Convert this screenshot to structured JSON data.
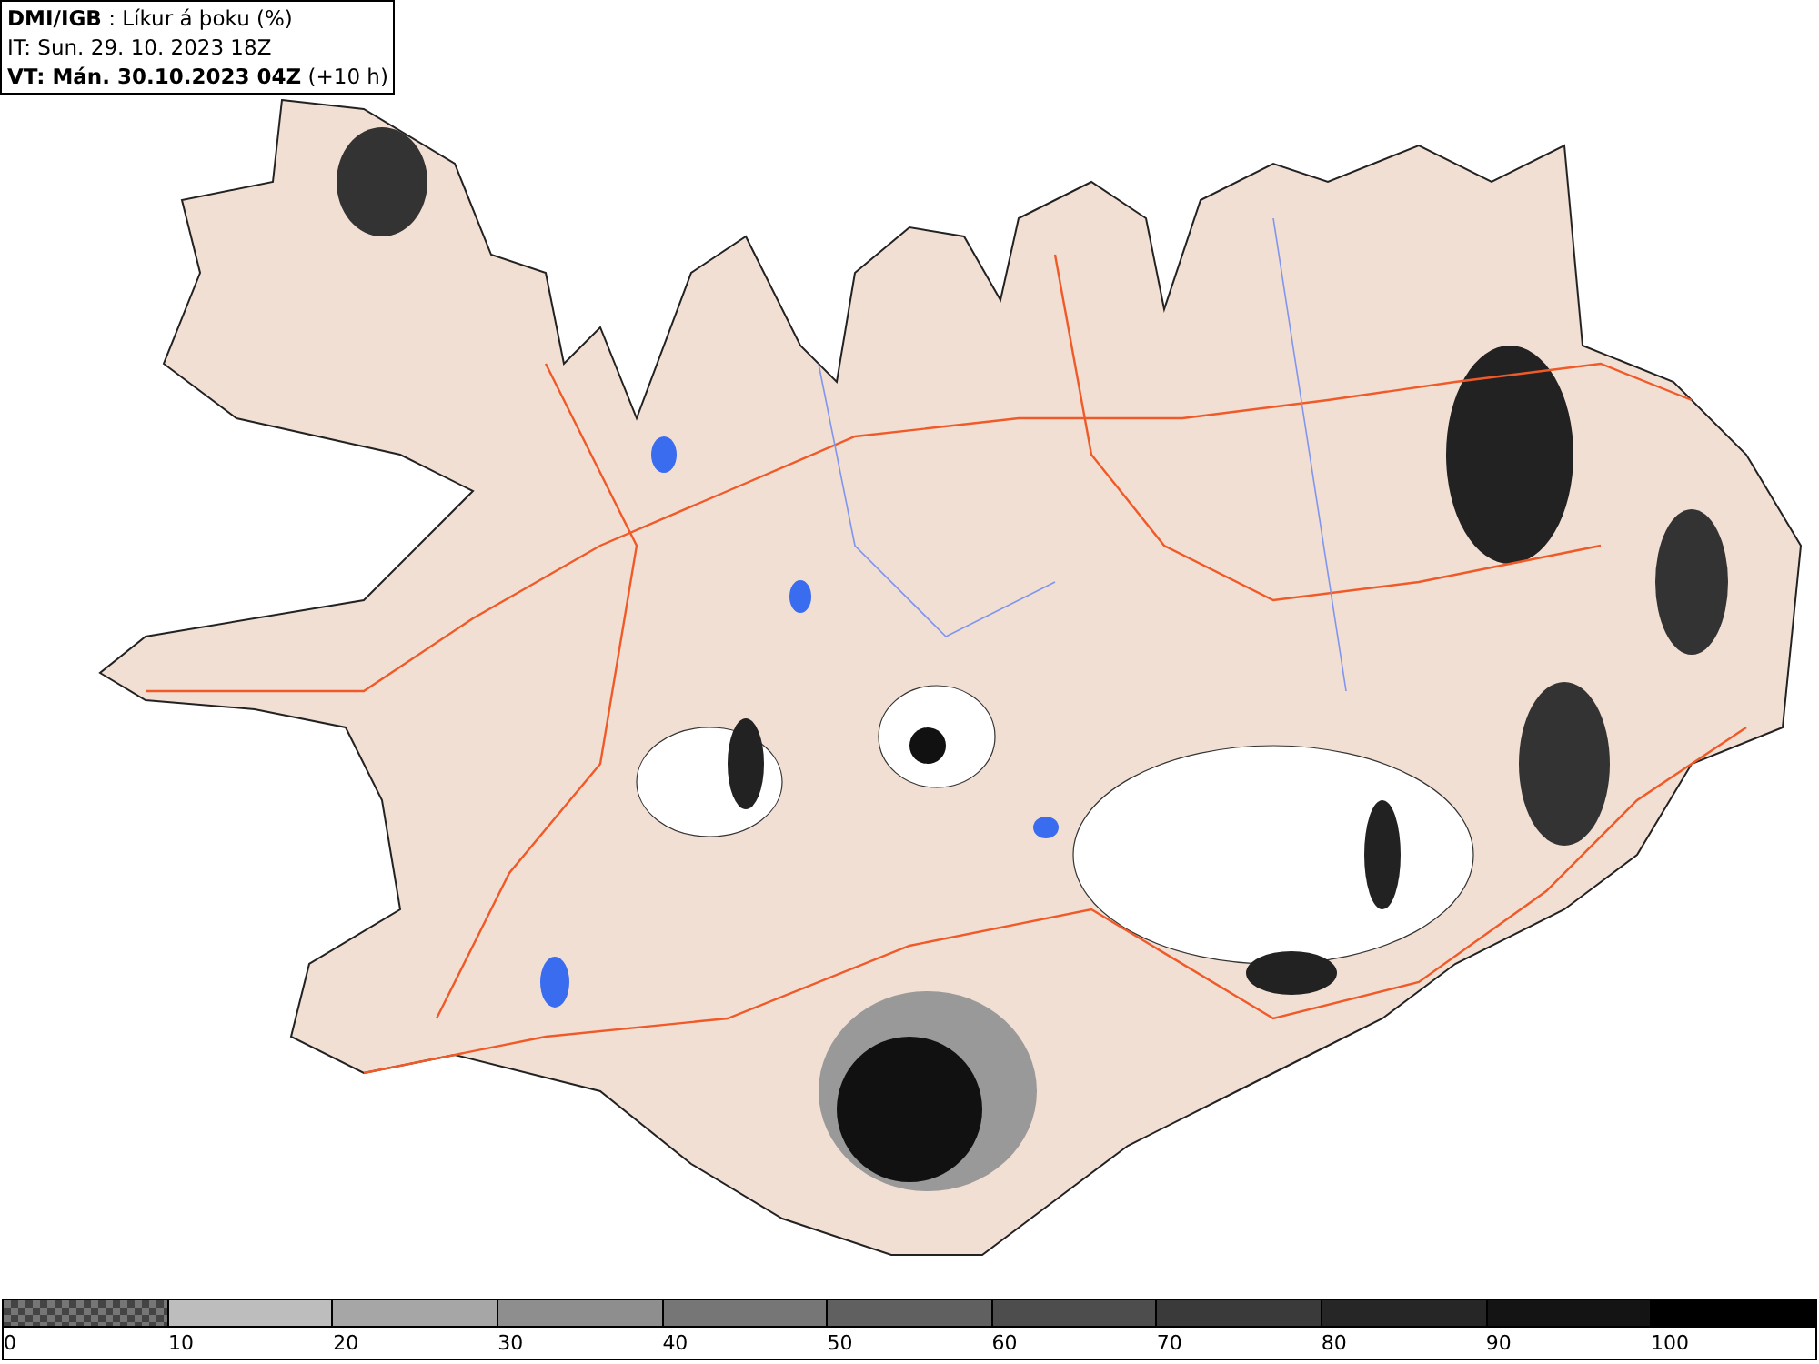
{
  "header": {
    "title": "**DMI/IGB** : Líkur á þoku (%)",
    "initial_time": "IT: Sun. 29. 10. 2023 18Z",
    "valid_time": "**VT: Mán. 30.10.2023 04Z** (+10 h)"
  },
  "legend": {
    "segments": [
      {
        "kind": "pattern",
        "color": "#767676"
      },
      {
        "kind": "solid",
        "color": "#bdbdbd"
      },
      {
        "kind": "solid",
        "color": "#a6a6a6"
      },
      {
        "kind": "solid",
        "color": "#8e8e8e"
      },
      {
        "kind": "solid",
        "color": "#767676"
      },
      {
        "kind": "solid",
        "color": "#606060"
      },
      {
        "kind": "solid",
        "color": "#4d4d4d"
      },
      {
        "kind": "solid",
        "color": "#3a3a3a"
      },
      {
        "kind": "solid",
        "color": "#262626"
      },
      {
        "kind": "solid",
        "color": "#141414"
      },
      {
        "kind": "solid",
        "color": "#000000"
      }
    ],
    "ticks": [
      "0",
      "10",
      "20",
      "30",
      "40",
      "50",
      "60",
      "70",
      "80",
      "90",
      "100"
    ]
  }
}
